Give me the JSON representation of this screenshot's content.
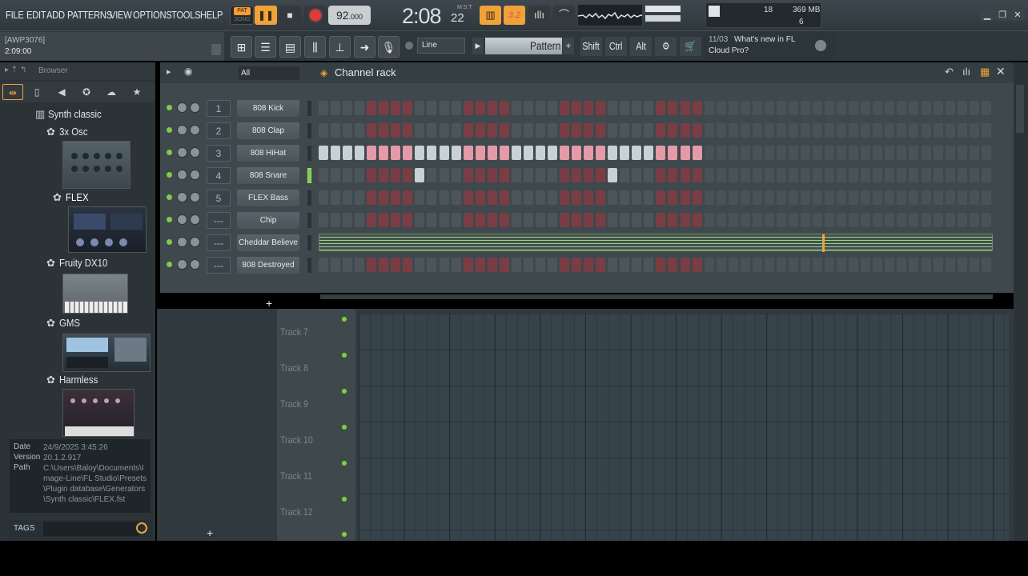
{
  "menu": [
    "FILE",
    "EDIT",
    "ADD",
    "PATTERNS",
    "VIEW",
    "OPTIONS",
    "TOOLS",
    "HELP"
  ],
  "transport": {
    "pat_label": "PAT",
    "song_label": "SONG",
    "play_icon": "pause-icon",
    "tempo_main": "92",
    "tempo_frac": ".000",
    "time_main": "2:08",
    "time_small": "22",
    "time_unit": "M:S:T"
  },
  "system": {
    "cpu": "18",
    "memory": "369 MB",
    "polyphony": "6"
  },
  "hint": {
    "title": "[AWP3076]",
    "value": "2:09:00"
  },
  "toolbar2": {
    "snap": "Line",
    "pattern": "Pattern 1",
    "shift": "Shift",
    "ctrl": "Ctrl",
    "alt": "Alt"
  },
  "news": {
    "date": "11/03",
    "line1": "What's new in FL",
    "line2": "Cloud Pro?"
  },
  "browser": {
    "title": "Browser",
    "folder": "Synth classic",
    "plugins": [
      {
        "name": "3x Osc",
        "top": 0
      },
      {
        "name": "FLEX",
        "top": 0
      },
      {
        "name": "Fruity DX10",
        "top": 0
      },
      {
        "name": "GMS",
        "top": 0
      },
      {
        "name": "Harmless",
        "top": 0
      }
    ],
    "info": {
      "date_label": "Date",
      "date": "24/9/2025 3:45:26",
      "version_label": "Version",
      "version": "20.1.2.917",
      "path_label": "Path",
      "path": "C:\\Users\\Baloy\\Documents\\Image-Line\\FL Studio\\Presets\\Plugin database\\Generators\\Synth classic\\FLEX.fst"
    },
    "tags_label": "TAGS"
  },
  "rack": {
    "filter": "All",
    "title": "Channel rack",
    "channels": [
      {
        "num": "1",
        "name": "808 Kick",
        "active": [],
        "lit": false
      },
      {
        "num": "2",
        "name": "808 Clap",
        "active": [],
        "lit": false
      },
      {
        "num": "3",
        "name": "808 HiHat",
        "active": "all",
        "lit": false
      },
      {
        "num": "4",
        "name": "808 Snare",
        "active": [
          8,
          24
        ],
        "lit": true
      },
      {
        "num": "5",
        "name": "FLEX Bass",
        "active": [],
        "lit": false
      },
      {
        "num": "---",
        "name": "Chip",
        "active": [],
        "lit": false
      },
      {
        "num": "---",
        "name": "Cheddar Believe",
        "active": "roll",
        "lit": false
      },
      {
        "num": "---",
        "name": "808 Destroyed",
        "active": [],
        "lit": false
      }
    ]
  },
  "playlist": {
    "tracks": [
      "Track 7",
      "Track 8",
      "Track 9",
      "Track 10",
      "Track 11",
      "Track 12"
    ]
  },
  "colors": {
    "accent": "#f0a23a",
    "led": "#7fcb4a",
    "step_red": "#7a3d44",
    "step_gray": "#4b555a"
  }
}
